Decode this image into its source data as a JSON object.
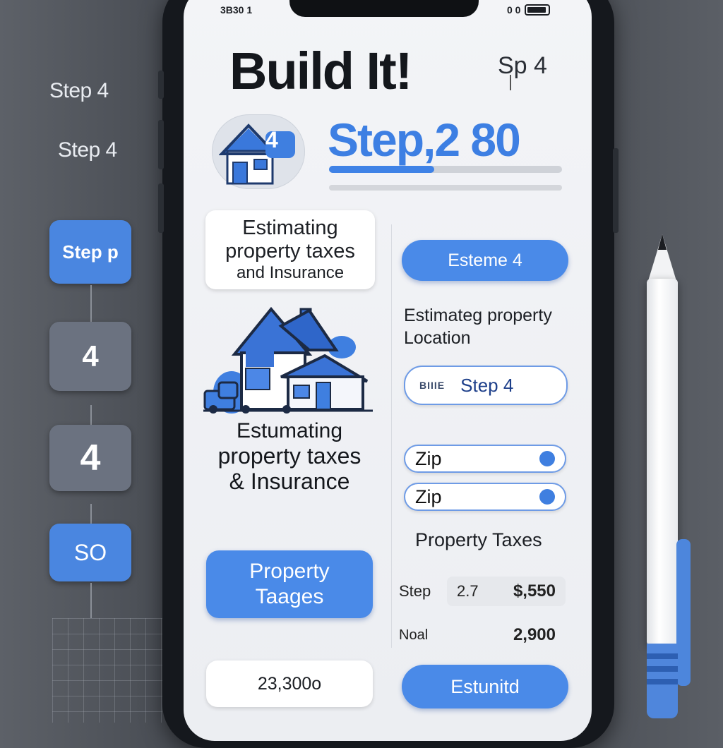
{
  "status_bar": {
    "left": "3B30 1",
    "right": "0 0"
  },
  "left_rail": {
    "text1": "Step 4",
    "text2": "Step 4",
    "tile1": "Step p",
    "tile2": "4",
    "tile3": "4",
    "tile4": "SO"
  },
  "header": {
    "title": "Build It!",
    "step_small": "Sp 4"
  },
  "hero": {
    "house_badge": "4",
    "step_big": "Step,2 80",
    "progress": 0.45
  },
  "left_col": {
    "card_l1": "Estimating",
    "card_l2": "property taxes",
    "card_l3": "and Insurance",
    "caption_l1": "Estumating",
    "caption_l2": "property taxes",
    "caption_l3": "& Insurance",
    "property_button_l1": "Property",
    "property_button_l2": "Taages",
    "amount": "23,300o"
  },
  "right_col": {
    "esteme_button": "Esteme 4",
    "location_l1": "Estimateg property",
    "location_l2": "Location",
    "step_field_prefix": "BIIIE",
    "step_field_label": "Step 4",
    "zip1": "Zip",
    "zip2": "Zip",
    "property_taxes": "Property Taxes",
    "row1": {
      "label": "Step",
      "mid": "2.7",
      "value": "$,550"
    },
    "row2": {
      "label": "Noal",
      "value": "2,900"
    },
    "estimate_button": "Estunitd"
  },
  "colors": {
    "accent": "#4a8ae8",
    "dark": "#14171c"
  }
}
